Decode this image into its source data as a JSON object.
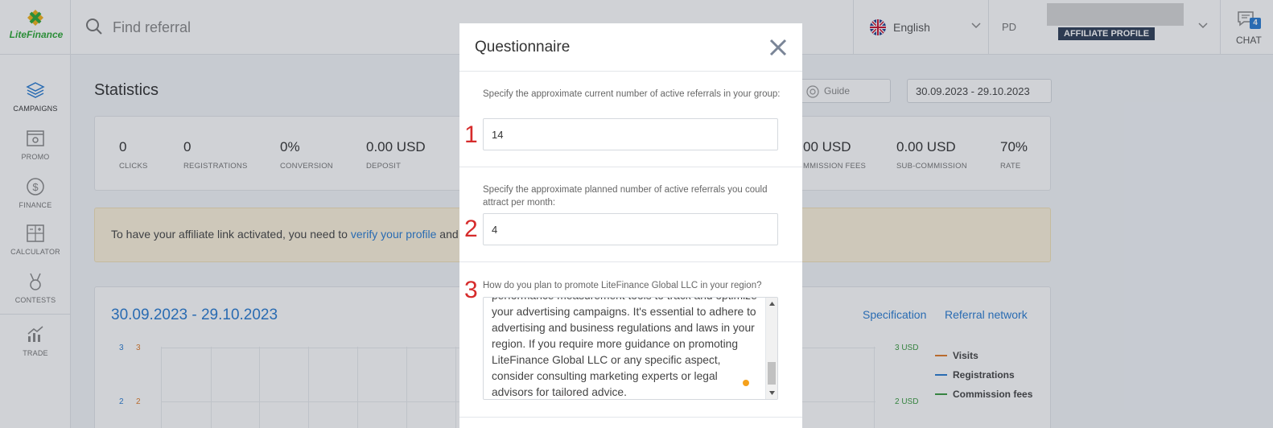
{
  "app": {
    "brand": "LiteFinance"
  },
  "search": {
    "placeholder": "Find referral"
  },
  "header": {
    "language": "English",
    "profile_initials": "PD",
    "profile_badge": "AFFILIATE PROFILE",
    "chat_label": "CHAT",
    "chat_count": "4"
  },
  "sidebar": {
    "items": [
      {
        "label": "CAMPAIGNS",
        "icon": "layers-icon"
      },
      {
        "label": "PROMO",
        "icon": "promo-icon"
      },
      {
        "label": "FINANCE",
        "icon": "dollar-icon"
      },
      {
        "label": "CALCULATOR",
        "icon": "calculator-icon"
      },
      {
        "label": "CONTESTS",
        "icon": "medal-icon"
      },
      {
        "label": "TRADE",
        "icon": "chart-icon"
      }
    ]
  },
  "main": {
    "title": "Statistics",
    "guide_label": "Guide",
    "date_range": "30.09.2023 - 29.10.2023",
    "stats": [
      {
        "value": "0",
        "caption": "CLICKS"
      },
      {
        "value": "0",
        "caption": "REGISTRATIONS"
      },
      {
        "value": "0%",
        "caption": "CONVERSION"
      },
      {
        "value": "0.00 USD",
        "caption": "DEPOSIT"
      },
      {
        "value": "00 USD",
        "caption": "MMISSION FEES"
      },
      {
        "value": "0.00 USD",
        "caption": "SUB-COMMISSION"
      },
      {
        "value": "70%",
        "caption": "RATE"
      }
    ],
    "notice": {
      "text_before": "To have your affiliate link activated, you need to ",
      "link": "verify your profile",
      "text_after": " and f"
    },
    "chart_section": {
      "date": "30.09.2023 - 29.10.2023",
      "link_specification": "Specification",
      "link_network": "Referral network"
    }
  },
  "chart_data": {
    "type": "line",
    "title": "",
    "left_ticks_a": [
      "3",
      "2"
    ],
    "left_ticks_b": [
      "3",
      "2"
    ],
    "right_ticks": [
      "3 USD",
      "2 USD"
    ],
    "series": [
      {
        "name": "Visits",
        "color": "#e07b28"
      },
      {
        "name": "Registrations",
        "color": "#2a7cd1"
      },
      {
        "name": "Commission fees",
        "color": "#3a9a3f"
      }
    ]
  },
  "modal": {
    "title": "Questionnaire",
    "questions": [
      {
        "number": "1",
        "label": "Specify the approximate current number of active referrals in your group:",
        "value": "14"
      },
      {
        "number": "2",
        "label": "Specify the approximate planned number of active referrals you could attract per month:",
        "value": "4"
      },
      {
        "number": "3",
        "label": "How do you plan to promote LiteFinance Global LLC in your region?",
        "value": "performance measurement tools to track and optimize your advertising campaigns. It's essential to adhere to advertising and business regulations and laws in your region. If you require more guidance on promoting LiteFinance Global LLC or any specific aspect, consider consulting marketing experts or legal advisors for tailored advice."
      }
    ]
  },
  "colors": {
    "accent": "#2a7cd1",
    "brand_green": "#2ea836",
    "annotation_red": "#d62b2b",
    "notice_bg": "#fdf3dc"
  }
}
